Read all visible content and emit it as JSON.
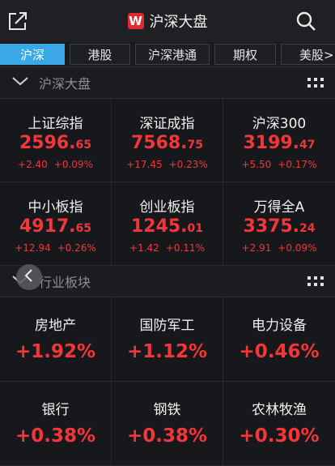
{
  "header": {
    "logo_letter": "W",
    "title": "沪深大盘",
    "left_icon": "share-icon",
    "right_icon": "search-icon"
  },
  "tabs": [
    {
      "label": "沪深",
      "active": true
    },
    {
      "label": "港股",
      "active": false
    },
    {
      "label": "沪深港通",
      "active": false
    },
    {
      "label": "期权",
      "active": false
    },
    {
      "label": "美股>",
      "active": false
    }
  ],
  "market_section": {
    "title": "沪深大盘",
    "indices": [
      {
        "name": "上证综指",
        "price_int": "2596.",
        "price_dec": "65",
        "change": "+2.40",
        "pct": "+0.09%"
      },
      {
        "name": "深证成指",
        "price_int": "7568.",
        "price_dec": "75",
        "change": "+17.45",
        "pct": "+0.23%"
      },
      {
        "name": "沪深300",
        "price_int": "3199.",
        "price_dec": "47",
        "change": "+5.50",
        "pct": "+0.17%"
      },
      {
        "name": "中小板指",
        "price_int": "4917.",
        "price_dec": "65",
        "change": "+12.94",
        "pct": "+0.26%"
      },
      {
        "name": "创业板指",
        "price_int": "1245.",
        "price_dec": "01",
        "change": "+1.42",
        "pct": "+0.11%"
      },
      {
        "name": "万得全A",
        "price_int": "3375.",
        "price_dec": "24",
        "change": "+2.91",
        "pct": "+0.09%"
      }
    ]
  },
  "industry_section": {
    "title": "行业板块",
    "sectors": [
      {
        "name": "房地产",
        "pct": "+1.92%"
      },
      {
        "name": "国防军工",
        "pct": "+1.12%"
      },
      {
        "name": "电力设备",
        "pct": "+0.46%"
      },
      {
        "name": "银行",
        "pct": "+0.38%"
      },
      {
        "name": "钢铁",
        "pct": "+0.38%"
      },
      {
        "name": "农林牧渔",
        "pct": "+0.30%"
      }
    ]
  },
  "colors": {
    "up": "#f2363a",
    "accent": "#3aa7e6",
    "bg": "#16171b"
  }
}
